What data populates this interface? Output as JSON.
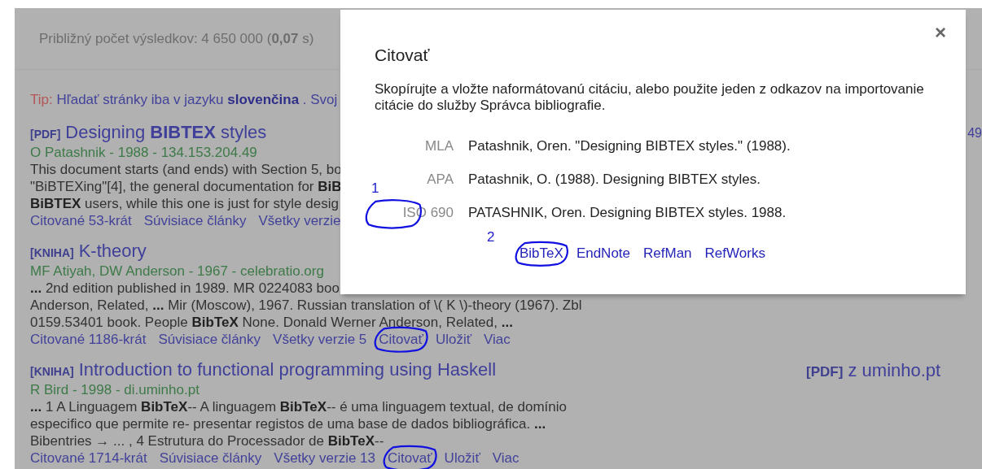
{
  "summary": "Približný počet výsledkov: 4 650 000 (**0,07** s)",
  "tip": {
    "label": "Tip:",
    "text": "Hľadať stránky iba v jazyku **slovenčina** . Svoj"
  },
  "results": [
    {
      "type": "[PDF]",
      "title": "Designing **BIBTEX** styles",
      "meta": "O Patashnik - 1988 - 134.153.204.49",
      "side": {
        "text": "49"
      },
      "snippet": [
        "This document starts (and ends) with Section 5, bo",
        "\"BiBTEXing\"[4], the general documentation for **BiB**",
        "**BiBTEX** users, while this one is just for style desig"
      ],
      "links": [
        {
          "label": "Citované 53-krát",
          "circled": false
        },
        {
          "label": "Súvisiace články",
          "circled": false
        },
        {
          "label": "Všetky verzie",
          "circled": false
        }
      ]
    },
    {
      "type": "[KNIHA]",
      "title": "K-theory",
      "meta": "MF Atiyah, DW Anderson - 1967 - celebratio.org",
      "snippet": [
        "**...** 2nd edition published in 1989. MR 0224083 boo",
        "Anderson, Related, **...** Mir (Moscow), 1967. Russian translation of \\( K \\)-theory (1967). Zbl",
        "0159.53401 book. People **BibTeX** None. Donald Werner Anderson, Related, **...**"
      ],
      "links": [
        {
          "label": "Citované 1186-krát",
          "circled": false
        },
        {
          "label": "Súvisiace články",
          "circled": false
        },
        {
          "label": "Všetky verzie 5",
          "circled": false
        },
        {
          "label": "Citovať",
          "circled": true
        },
        {
          "label": "Uložiť",
          "circled": false
        },
        {
          "label": "Viac",
          "circled": false
        }
      ]
    },
    {
      "type": "[KNIHA]",
      "title": "Introduction to functional programming using Haskell",
      "meta": "R Bird - 1998 - di.uminho.pt",
      "side": {
        "tag": "[PDF]",
        "text": "z uminho.pt"
      },
      "snippet": [
        "**...** 1 A Linguagem **BibTeX**-- A linguagem **BibTeX**-- é uma linguagem textual, de domínio",
        "especifico que permite re- presentar registos de uma base de dados bibliográfica. **...**",
        "Bibentries → ... , 4 Estrutura do Processador de **BibTeX**--"
      ],
      "links": [
        {
          "label": "Citované 1714-krát",
          "circled": false
        },
        {
          "label": "Súvisiace články",
          "circled": false
        },
        {
          "label": "Všetky verzie 13",
          "circled": false
        },
        {
          "label": "Citovať",
          "circled": true
        },
        {
          "label": "Uložiť",
          "circled": false
        },
        {
          "label": "Viac",
          "circled": false
        }
      ]
    }
  ],
  "dialog": {
    "title": "Citovať",
    "close": "×",
    "description": "Skopírujte a vložte naformátovanú citáciu, alebo použite jeden z odkazov na importovanie citácie do služby Správca bibliografie.",
    "styles": [
      {
        "label": "MLA",
        "citation": "Patashnik, Oren. \"Designing BIBTEX styles.\" (1988).",
        "circled": false
      },
      {
        "label": "APA",
        "citation": "Patashnik, O. (1988). Designing BIBTEX styles.",
        "circled": false
      },
      {
        "label": "ISO 690",
        "citation": "PATASHNIK, Oren. Designing BIBTEX styles. 1988.",
        "circled": true,
        "annotation": "1"
      }
    ],
    "exports": [
      {
        "label": "BibTeX",
        "circled": true,
        "annotation": "2"
      },
      {
        "label": "EndNote",
        "circled": false
      },
      {
        "label": "RefMan",
        "circled": false
      },
      {
        "label": "RefWorks",
        "circled": false
      }
    ]
  }
}
